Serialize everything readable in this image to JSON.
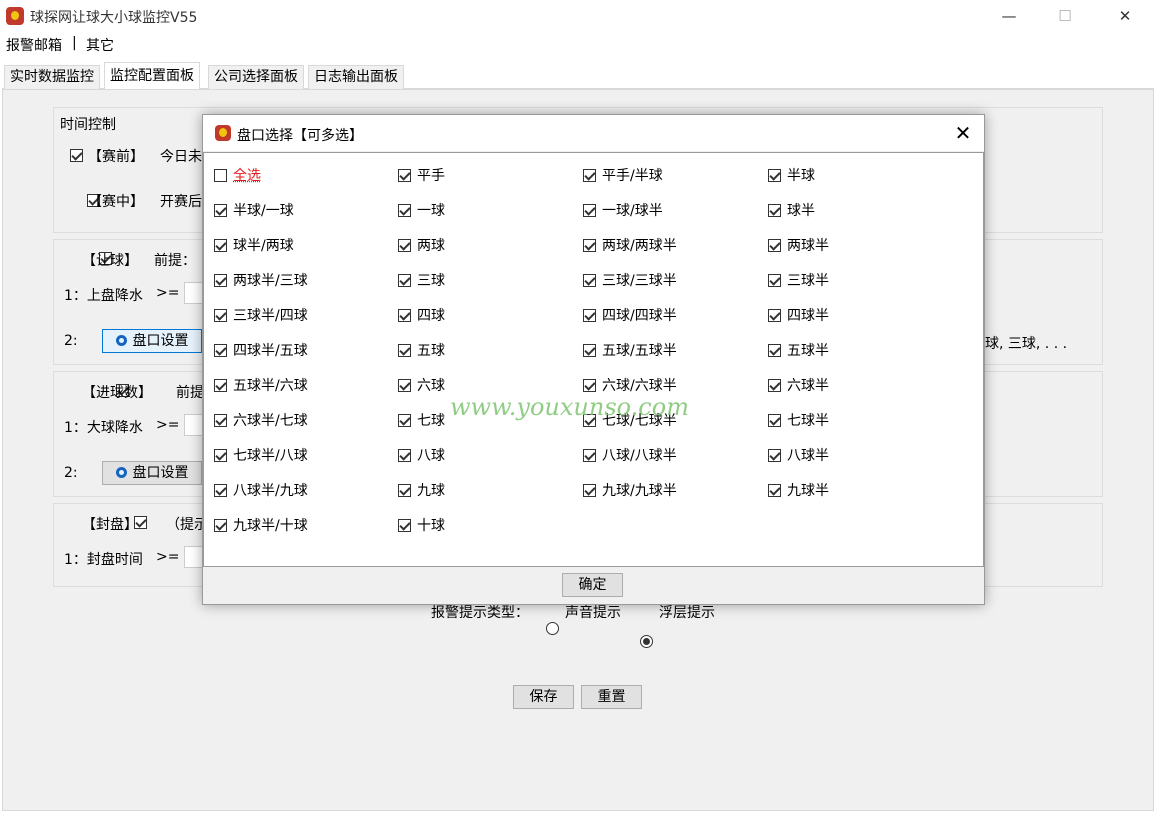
{
  "window": {
    "title": "球探网让球大小球监控V55",
    "minimize": "—",
    "maximize": "☐",
    "close": "✕"
  },
  "menu": [
    "报警邮箱",
    "|",
    "其它"
  ],
  "tabs": [
    "实时数据监控",
    "监控配置面板",
    "公司选择面板",
    "日志输出面板"
  ],
  "time_control": {
    "title": "时间控制",
    "pre": "【赛前】",
    "pre_text": "今日未",
    "live": "【赛中】",
    "live_text": "开赛后"
  },
  "handicap_group": {
    "label": "【让球】",
    "premise": "前提：",
    "row1": "1：上盘降水",
    "ge": ">=",
    "row2": "2:",
    "button": "盘口设置",
    "right_text": "球, 三球, . . ."
  },
  "goals_group": {
    "label": "【进球数】",
    "premise": "前提",
    "row1": "1：大球降水",
    "ge": ">=",
    "row2": "2:",
    "button": "盘口设置"
  },
  "seal_group": {
    "label": "【封盘】",
    "hint": "（提示",
    "row1": "1：封盘时间",
    "ge": ">="
  },
  "alert": {
    "label": "报警提示类型：",
    "sound": "声音提示",
    "float": "浮层提示",
    "selected": "float"
  },
  "actions": {
    "save": "保存",
    "reset": "重置"
  },
  "dialog": {
    "title": "盘口选择【可多选】",
    "close": "✕",
    "confirm": "确定",
    "options": [
      {
        "label": "全选",
        "checked": false,
        "special": true
      },
      {
        "label": "平手",
        "checked": true
      },
      {
        "label": "平手/半球",
        "checked": true
      },
      {
        "label": "半球",
        "checked": true
      },
      {
        "label": "半球/一球",
        "checked": true
      },
      {
        "label": "一球",
        "checked": true
      },
      {
        "label": "一球/球半",
        "checked": true
      },
      {
        "label": "球半",
        "checked": true
      },
      {
        "label": "球半/两球",
        "checked": true
      },
      {
        "label": "两球",
        "checked": true
      },
      {
        "label": "两球/两球半",
        "checked": true
      },
      {
        "label": "两球半",
        "checked": true
      },
      {
        "label": "两球半/三球",
        "checked": true
      },
      {
        "label": "三球",
        "checked": true
      },
      {
        "label": "三球/三球半",
        "checked": true
      },
      {
        "label": "三球半",
        "checked": true
      },
      {
        "label": "三球半/四球",
        "checked": true
      },
      {
        "label": "四球",
        "checked": true
      },
      {
        "label": "四球/四球半",
        "checked": true
      },
      {
        "label": "四球半",
        "checked": true
      },
      {
        "label": "四球半/五球",
        "checked": true
      },
      {
        "label": "五球",
        "checked": true
      },
      {
        "label": "五球/五球半",
        "checked": true
      },
      {
        "label": "五球半",
        "checked": true
      },
      {
        "label": "五球半/六球",
        "checked": true
      },
      {
        "label": "六球",
        "checked": true
      },
      {
        "label": "六球/六球半",
        "checked": true
      },
      {
        "label": "六球半",
        "checked": true
      },
      {
        "label": "六球半/七球",
        "checked": true
      },
      {
        "label": "七球",
        "checked": true
      },
      {
        "label": "七球/七球半",
        "checked": true
      },
      {
        "label": "七球半",
        "checked": true
      },
      {
        "label": "七球半/八球",
        "checked": true
      },
      {
        "label": "八球",
        "checked": true
      },
      {
        "label": "八球/八球半",
        "checked": true
      },
      {
        "label": "八球半",
        "checked": true
      },
      {
        "label": "八球半/九球",
        "checked": true
      },
      {
        "label": "九球",
        "checked": true
      },
      {
        "label": "九球/九球半",
        "checked": true
      },
      {
        "label": "九球半",
        "checked": true
      },
      {
        "label": "九球半/十球",
        "checked": true
      },
      {
        "label": "十球",
        "checked": true
      }
    ]
  },
  "watermark": "www.youxunso.com"
}
